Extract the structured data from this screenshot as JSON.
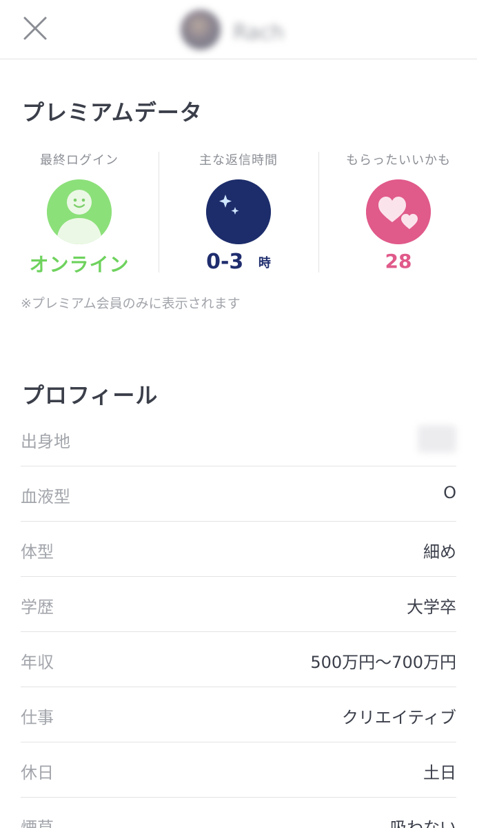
{
  "header": {
    "close_icon": "close-icon",
    "user_name": "Rach"
  },
  "premium": {
    "title": "プレミアムデータ",
    "stats": [
      {
        "label": "最終ログイン",
        "value": "オンライン",
        "icon": "smiley-person-icon",
        "color": "#6ed25d",
        "bg": "#8ce07a"
      },
      {
        "label": "主な返信時間",
        "value": "0-3",
        "unit": "時",
        "icon": "moon-stars-icon",
        "color": "#1f2d6e",
        "bg": "#1d2d6b"
      },
      {
        "label": "もらったいいかも",
        "value": "28",
        "icon": "hearts-icon",
        "color": "#e05a8a",
        "bg": "#e05a8a"
      }
    ],
    "note": "※プレミアム会員のみに表示されます"
  },
  "profile": {
    "title": "プロフィール",
    "rows": [
      {
        "label": "出身地",
        "value": ""
      },
      {
        "label": "血液型",
        "value": "O"
      },
      {
        "label": "体型",
        "value": "細め"
      },
      {
        "label": "学歴",
        "value": "大学卒"
      },
      {
        "label": "年収",
        "value": "500万円〜700万円"
      },
      {
        "label": "仕事",
        "value": "クリエイティブ"
      },
      {
        "label": "休日",
        "value": "土日"
      },
      {
        "label": "煙草",
        "value": "吸わない"
      }
    ]
  }
}
